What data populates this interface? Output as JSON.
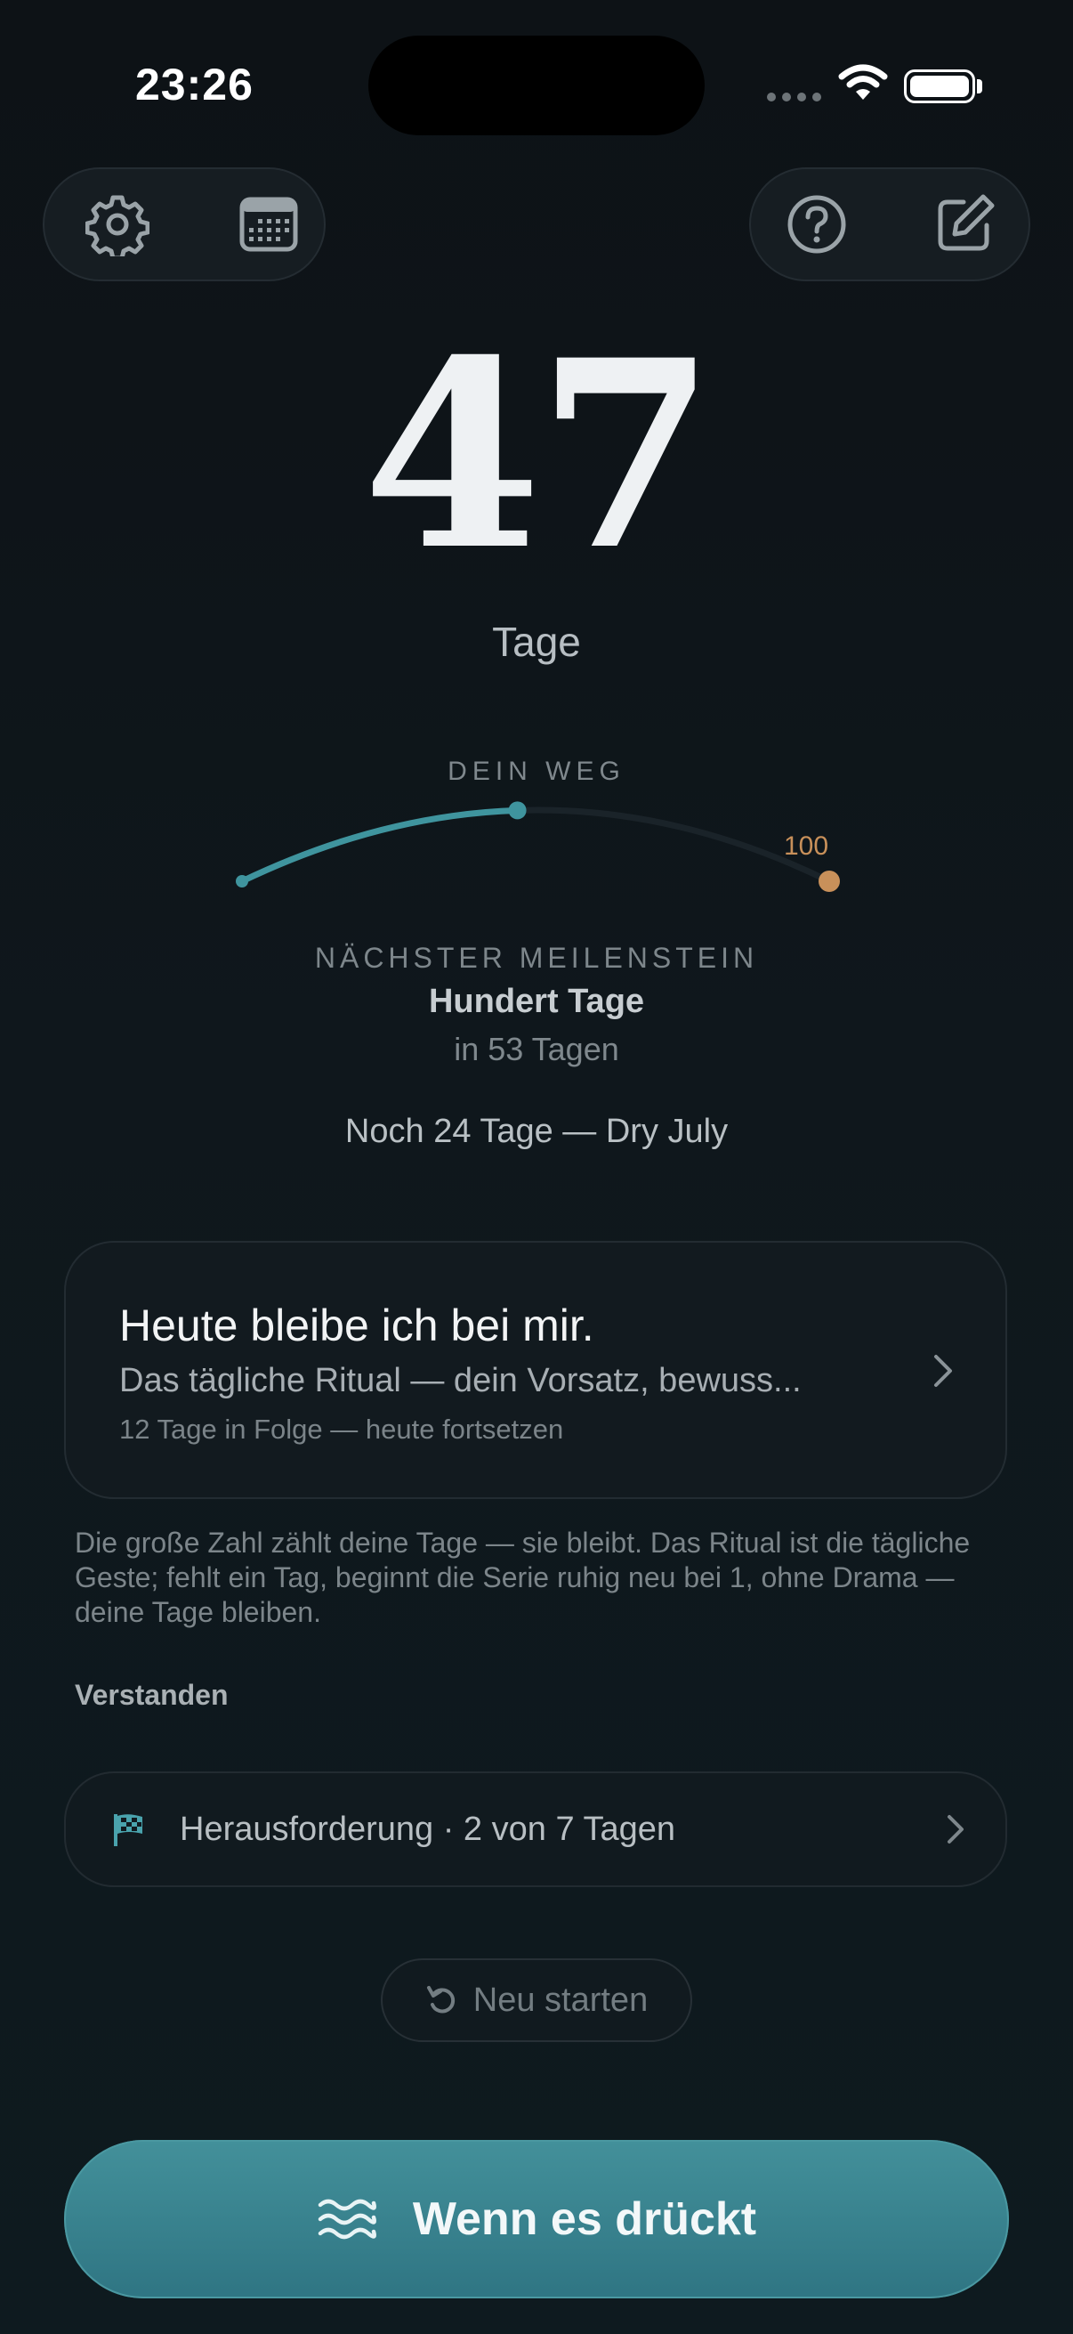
{
  "status_bar": {
    "time": "23:26"
  },
  "toolbar": {
    "settings_icon": "gear-icon",
    "calendar_icon": "calendar-icon",
    "help_icon": "question-circle-icon",
    "edit_icon": "edit-square-icon"
  },
  "counter": {
    "value": "47",
    "unit": "Tage"
  },
  "path": {
    "header": "DEIN WEG",
    "goal_label": "100",
    "progress_fraction": 0.47,
    "accent_color": "#3f949e",
    "goal_color": "#c8905a"
  },
  "milestone": {
    "label": "NÄCHSTER MEILENSTEIN",
    "name": "Hundert Tage",
    "remaining": "in 53 Tagen"
  },
  "event_note": "Noch 24 Tage — Dry July",
  "ritual_card": {
    "title": "Heute bleibe ich bei mir.",
    "subtitle": "Das tägliche Ritual — dein Vorsatz, bewuss...",
    "meta": "12 Tage in Folge — heute fortsetzen"
  },
  "info_text": "Die große Zahl zählt deine Tage — sie bleibt. Das Ritual ist die tägliche Geste; fehlt ein Tag, beginnt die Serie ruhig neu bei 1, ohne Drama — deine Tage bleiben.",
  "understood_label": "Verstanden",
  "challenge": {
    "icon": "checkered-flag-icon",
    "label": "Herausforderung · 2 von 7 Tagen"
  },
  "restart_label": "Neu starten",
  "cta": {
    "icon": "waves-icon",
    "label": "Wenn es drückt"
  }
}
